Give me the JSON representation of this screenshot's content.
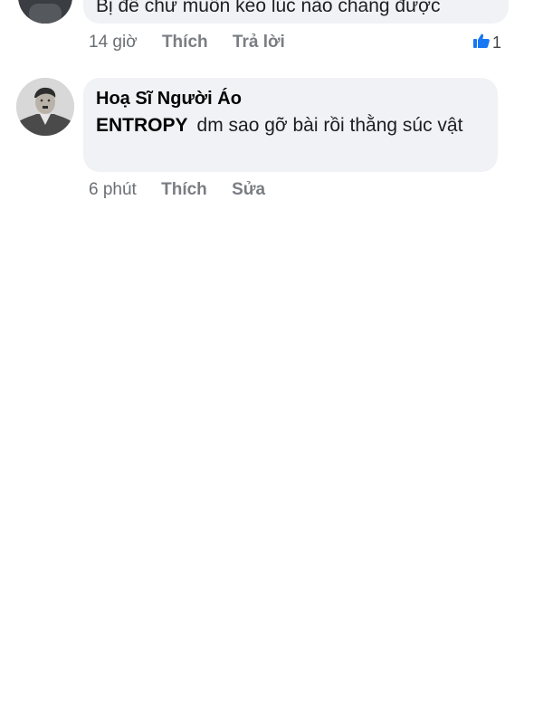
{
  "comments": [
    {
      "text": "Bị để chữ muốn kéo lúc nào chẳng được",
      "time": "14 giờ",
      "like_label": "Thích",
      "reply_label": "Trả lời",
      "reaction_icon": "like-icon",
      "reaction_count": "1",
      "accent": "#1877f2"
    },
    {
      "author": "Hoạ Sĩ Người Áo",
      "mention": "ENTROPY",
      "text": "dm sao gỡ bài rồi thằng súc vật",
      "time": "6 phút",
      "like_label": "Thích",
      "edit_label": "Sửa"
    }
  ],
  "colors": {
    "bubble": "#f0f2f5",
    "meta": "#6b6f74",
    "like_blue": "#1877f2"
  }
}
